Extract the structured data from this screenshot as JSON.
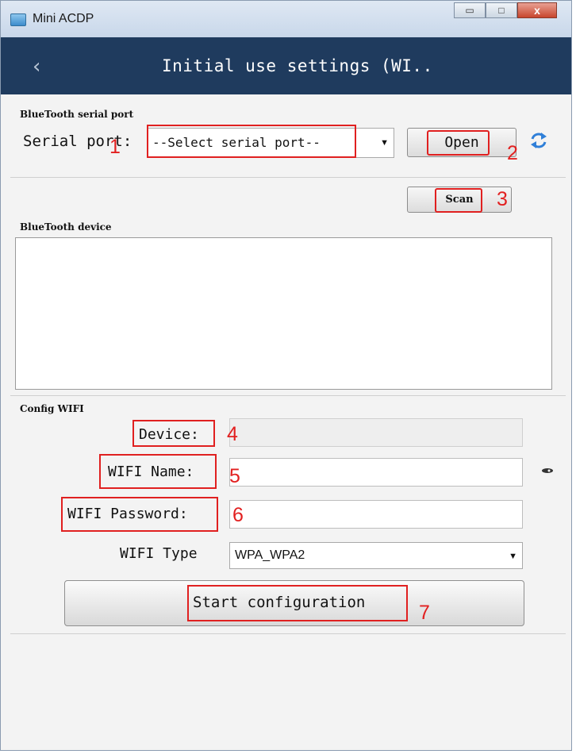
{
  "window": {
    "title": "Mini ACDP",
    "min_glyph": "▭",
    "max_glyph": "□",
    "close_glyph": "x"
  },
  "nav": {
    "back_glyph": "‹",
    "title": "Initial use settings (WI.."
  },
  "bluetooth_serial": {
    "section_label": "BlueTooth serial port",
    "serial_port_label": "Serial port:",
    "serial_port_value": "--Select serial port--",
    "open_label": "Open"
  },
  "scan": {
    "label": "Scan"
  },
  "bluetooth_device": {
    "section_label": "BlueTooth device",
    "items": []
  },
  "config_wifi": {
    "section_label": "Config WIFI",
    "device_label": "Device:",
    "device_value": "",
    "wifi_name_label": "WIFI Name:",
    "wifi_name_value": "",
    "wifi_password_label": "WIFI Password:",
    "wifi_password_value": "",
    "wifi_type_label": "WIFI Type",
    "wifi_type_value": "WPA_WPA2"
  },
  "start": {
    "label": "Start configuration"
  },
  "annotations": [
    "1",
    "2",
    "3",
    "4",
    "5",
    "6",
    "7"
  ],
  "colors": {
    "nav_bg": "#1f3b5e",
    "highlight": "#e02020",
    "refresh": "#2f7fd8"
  },
  "icons": {
    "back": "chevron-left-icon",
    "refresh": "refresh-icon",
    "eye": "eye-icon",
    "dropdown": "caret-down-icon"
  }
}
